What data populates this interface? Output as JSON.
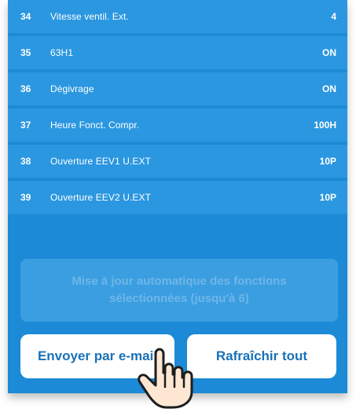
{
  "rows": [
    {
      "num": "34",
      "label": "Vitesse ventil. Ext.",
      "value": "4"
    },
    {
      "num": "35",
      "label": "63H1",
      "value": "ON"
    },
    {
      "num": "36",
      "label": "Dégivrage",
      "value": "ON"
    },
    {
      "num": "37",
      "label": "Heure Fonct. Compr.",
      "value": "100H"
    },
    {
      "num": "38",
      "label": "Ouverture EEV1 U.EXT",
      "value": "10P"
    },
    {
      "num": "39",
      "label": "Ouverture EEV2 U.EXT",
      "value": "10P"
    }
  ],
  "auto_update": {
    "label": "Mise à jour automatique des fonctions sélectionnées (jusqu'à 6)"
  },
  "buttons": {
    "email": "Envoyer par e-mail",
    "refresh": "Rafraîchir tout"
  },
  "colors": {
    "panel": "#1c8ad6",
    "row": "#2b97e0",
    "button_text": "#1871b8"
  },
  "icons": {
    "pointer": "hand-pointer-icon"
  }
}
